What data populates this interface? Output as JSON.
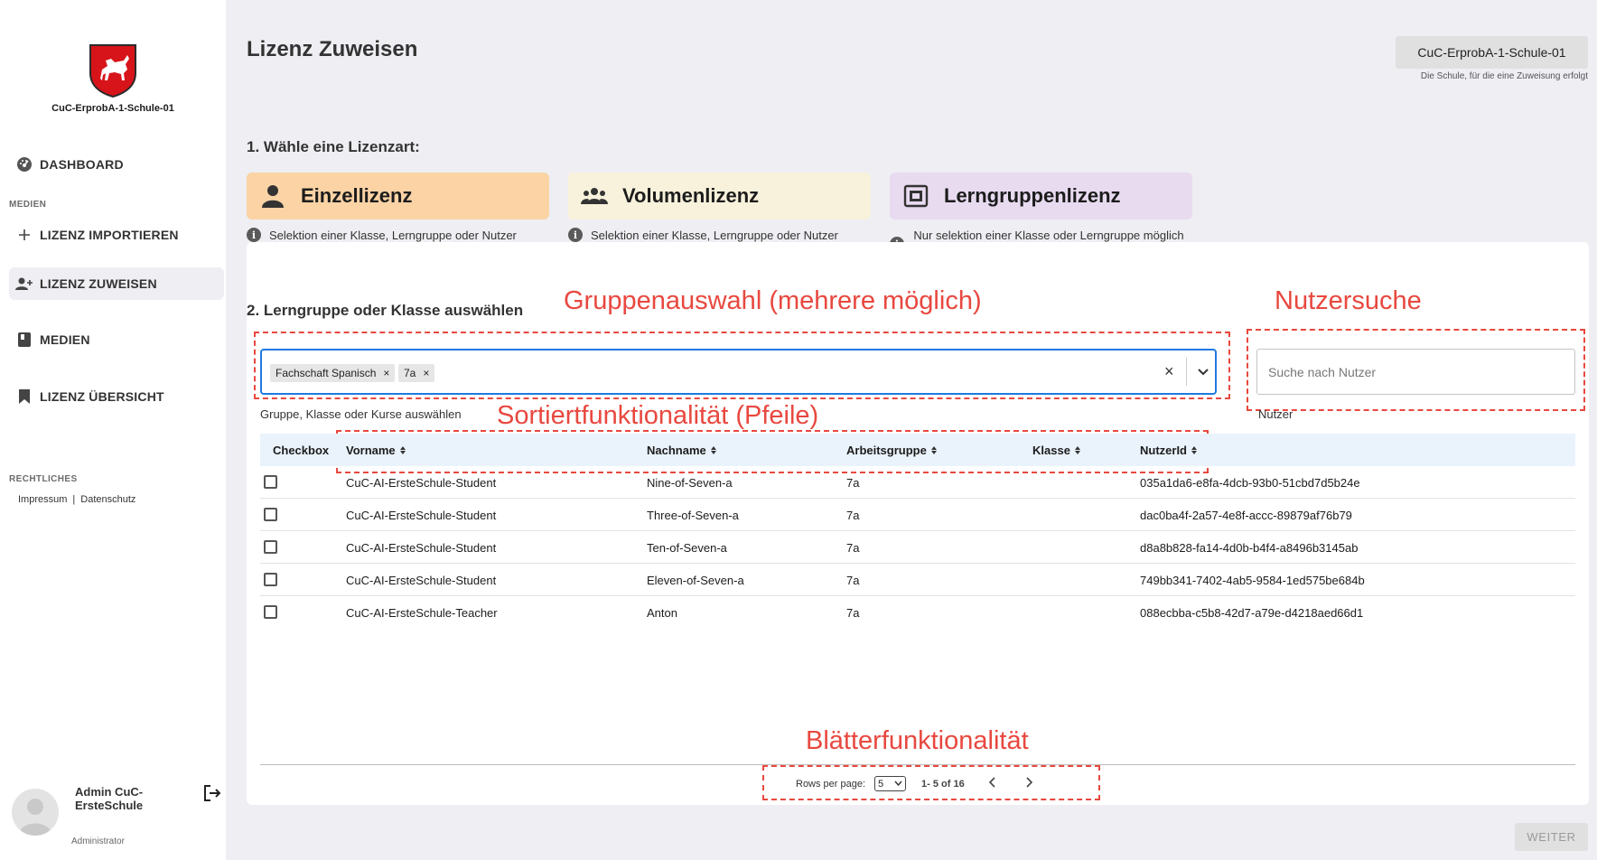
{
  "sidebar": {
    "school_name": "CuC-ErprobA-1-Schule-01",
    "dashboard": "DASHBOARD",
    "section_medien": "MEDIEN",
    "lizenz_importieren": "LIZENZ IMPORTIEREN",
    "lizenz_zuweisen": "LIZENZ ZUWEISEN",
    "medien": "MEDIEN",
    "lizenz_uebersicht": "LIZENZ ÜBERSICHT",
    "section_rechtliches": "RECHTLICHES",
    "impressum": "Impressum",
    "legal_separator": "|",
    "datenschutz": "Datenschutz",
    "user_name": "Admin CuC-ErsteSchule",
    "user_role": "Administrator"
  },
  "header": {
    "title": "Lizenz Zuweisen",
    "school_selector": "CuC-ErprobA-1-Schule-01",
    "school_hint": "Die Schule, für die eine Zuweisung erfolgt"
  },
  "step1": {
    "title": "1. Wähle eine Lizenzart:",
    "cards": [
      {
        "label": "Einzellizenz",
        "desc": "Selektion einer Klasse, Lerngruppe oder Nutzer",
        "color": "#fbd3a5"
      },
      {
        "label": "Volumenlizenz",
        "desc": "Selektion einer Klasse, Lerngruppe oder Nutzer",
        "color": "#f8f2dc"
      },
      {
        "label": "Lerngruppenlizenz",
        "desc": "Nur selektion einer Klasse oder Lerngruppe möglich",
        "color": "#e8dbf0"
      }
    ]
  },
  "step2": {
    "title": "2. Lerngruppe oder Klasse auswählen",
    "chips": [
      "Fachschaft Spanisch",
      "7a"
    ],
    "chip_remove": "×",
    "clear": "×",
    "group_helper": "Gruppe, Klasse oder Kurse auswählen",
    "search_placeholder": "Suche nach Nutzer",
    "search_helper": "Nutzer"
  },
  "annotations": {
    "group": "Gruppenauswahl (mehrere möglich)",
    "search": "Nutzersuche",
    "sort": "Sortiertfunktionalität (Pfeile)",
    "paging": "Blätterfunktionalität",
    "color": "#e8483f"
  },
  "table": {
    "headers": [
      "Checkbox",
      "Vorname",
      "Nachname",
      "Arbeitsgruppe",
      "Klasse",
      "NutzerId"
    ],
    "rows": [
      [
        "CuC-AI-ErsteSchule-Student",
        "Nine-of-Seven-a",
        "7a",
        "",
        "035a1da6-e8fa-4dcb-93b0-51cbd7d5b24e"
      ],
      [
        "CuC-AI-ErsteSchule-Student",
        "Three-of-Seven-a",
        "7a",
        "",
        "dac0ba4f-2a57-4e8f-accc-89879af76b79"
      ],
      [
        "CuC-AI-ErsteSchule-Student",
        "Ten-of-Seven-a",
        "7a",
        "",
        "d8a8b828-fa14-4d0b-b4f4-a8496b3145ab"
      ],
      [
        "CuC-AI-ErsteSchule-Student",
        "Eleven-of-Seven-a",
        "7a",
        "",
        "749bb341-7402-4ab5-9584-1ed575be684b"
      ],
      [
        "CuC-AI-ErsteSchule-Teacher",
        "Anton",
        "7a",
        "",
        "088ecbba-c5b8-42d7-a79e-d4218aed66d1"
      ]
    ]
  },
  "pagination": {
    "rows_label": "Rows per page:",
    "rows_value": "5",
    "range": "1- 5 of 16"
  },
  "footer": {
    "weiter": "WEITER"
  },
  "icons": {
    "dashboard": "dashboard-icon",
    "import": "plus-icon",
    "assign": "person-add-icon",
    "medien": "book-icon",
    "overview": "bookmark-icon",
    "logout": "logout-icon",
    "einzel": "person-icon",
    "volumen": "group-icon",
    "lerngruppe": "collection-icon",
    "info": "info-icon"
  }
}
